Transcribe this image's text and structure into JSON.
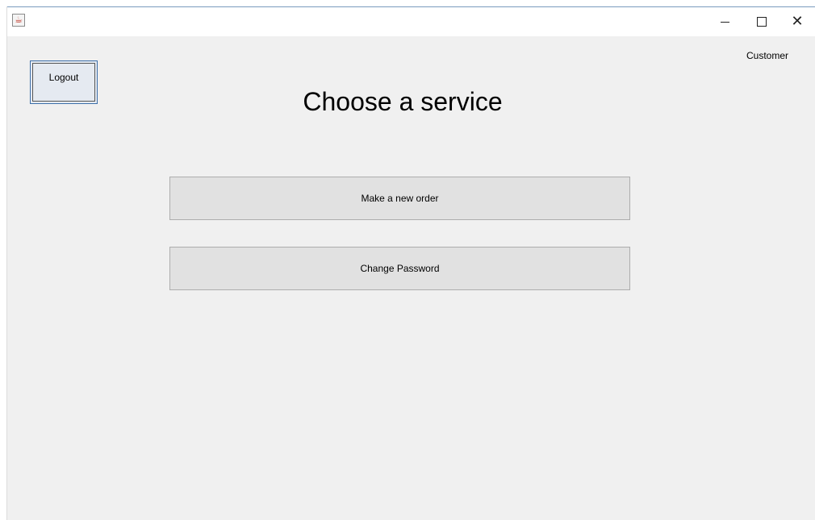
{
  "titlebar": {
    "app_icon": "java-icon",
    "minimize_icon": "minimize-icon",
    "maximize_icon": "maximize-icon",
    "close_icon": "close-icon",
    "close_glyph": "✕"
  },
  "header": {
    "logout_label": "Logout",
    "role_label": "Customer",
    "title": "Choose a service"
  },
  "services": {
    "new_order_label": "Make a new order",
    "change_password_label": "Change Password"
  },
  "colors": {
    "window_background": "#f0f0f0",
    "button_background": "#e1e1e1",
    "focused_button_border": "#3c6ea8"
  }
}
